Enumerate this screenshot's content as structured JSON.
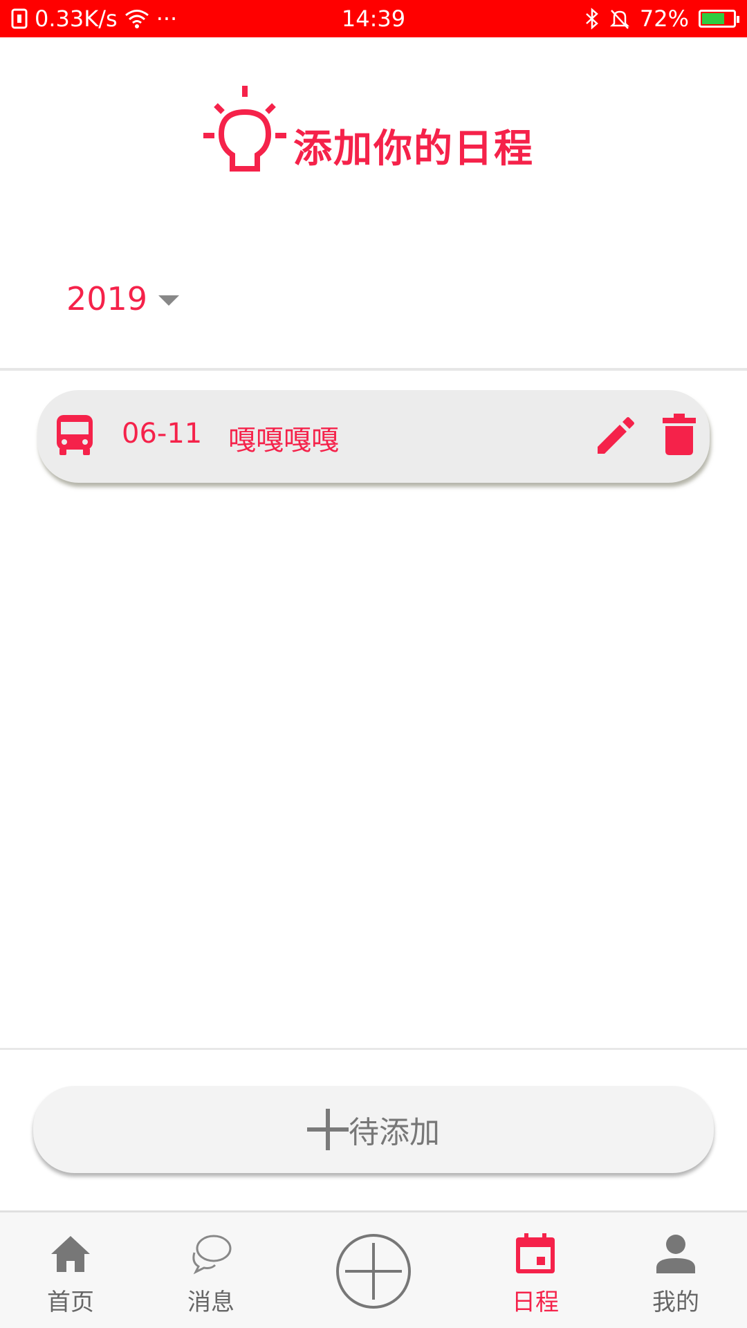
{
  "status_bar": {
    "network_speed": "0.33K/s",
    "more": "···",
    "time": "14:39",
    "battery_percent": "72%",
    "battery_level": 0.72,
    "bg_color": "#ff0000"
  },
  "header": {
    "title": "添加你的日程",
    "icon": "lightbulb-icon"
  },
  "year_select": {
    "value": "2019"
  },
  "schedules": [
    {
      "icon": "bus-icon",
      "date": "06-11",
      "text": "嘎嘎嘎嘎"
    }
  ],
  "add_button": {
    "label": "待添加"
  },
  "bottom_nav": {
    "items": [
      {
        "label": "首页",
        "icon": "home-icon"
      },
      {
        "label": "消息",
        "icon": "chat-icon"
      },
      {
        "label": "",
        "icon": "add-circle-icon"
      },
      {
        "label": "日程",
        "icon": "calendar-icon",
        "active": true
      },
      {
        "label": "我的",
        "icon": "person-icon"
      }
    ]
  },
  "colors": {
    "accent": "#f5224a",
    "inactive": "#666666"
  }
}
